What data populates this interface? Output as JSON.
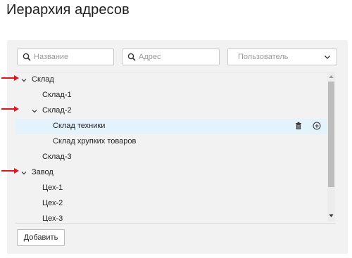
{
  "page": {
    "title": "Иерархия адресов"
  },
  "filters": {
    "name_placeholder": "Название",
    "address_placeholder": "Адрес",
    "user_placeholder": "Пользователь"
  },
  "tree": {
    "rows": [
      {
        "label": "Склад",
        "level": 0,
        "expandable": true,
        "expanded": true
      },
      {
        "label": "Склад-1",
        "level": 1,
        "expandable": false
      },
      {
        "label": "Склад-2",
        "level": 1,
        "expandable": true,
        "expanded": true
      },
      {
        "label": "Склад техники",
        "level": 2,
        "expandable": false,
        "selected": true
      },
      {
        "label": "Склад хрупких товаров",
        "level": 2,
        "expandable": false
      },
      {
        "label": "Склад-3",
        "level": 1,
        "expandable": false
      },
      {
        "label": "Завод",
        "level": 0,
        "expandable": true,
        "expanded": true
      },
      {
        "label": "Цех-1",
        "level": 1,
        "expandable": false
      },
      {
        "label": "Цех-2",
        "level": 1,
        "expandable": false
      },
      {
        "label": "Цех-3",
        "level": 1,
        "expandable": false
      }
    ]
  },
  "actions": {
    "add_label": "Добавить"
  },
  "icons": {
    "search": "search-icon",
    "dropdown": "chevron-down-icon",
    "expand": "chevron-down-icon",
    "delete": "trash-icon",
    "add_child": "plus-circle-icon",
    "annotation": "red-arrow-icon"
  },
  "colors": {
    "selected_row": "#e3f2fb",
    "annotation_arrow": "#e0141e"
  }
}
